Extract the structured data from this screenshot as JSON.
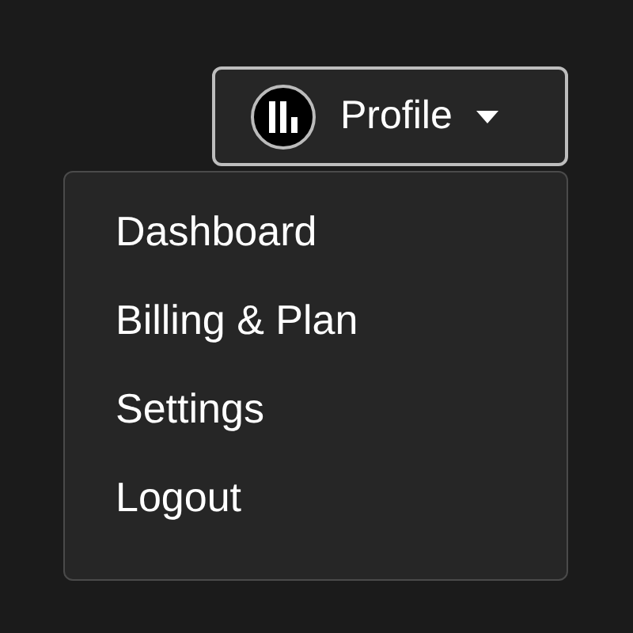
{
  "profile_button": {
    "label": "Profile",
    "expanded": true
  },
  "menu": {
    "items": [
      {
        "label": "Dashboard"
      },
      {
        "label": "Billing & Plan"
      },
      {
        "label": "Settings"
      },
      {
        "label": "Logout"
      }
    ]
  }
}
